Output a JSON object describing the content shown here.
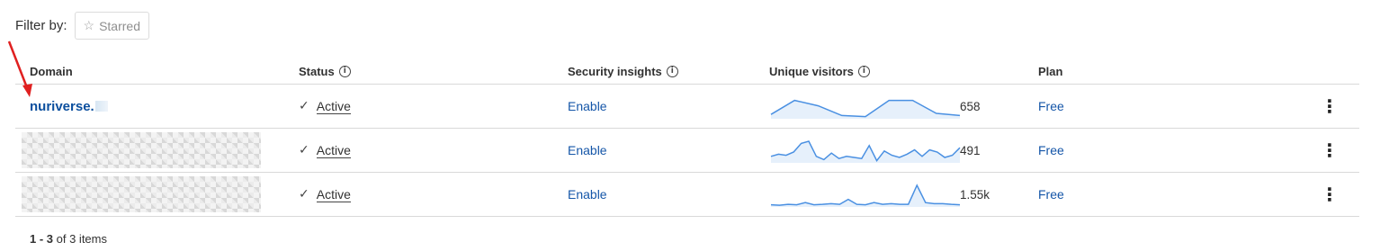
{
  "filter": {
    "label": "Filter by:",
    "starred_label": "Starred",
    "star_icon": "star-outline-icon"
  },
  "columns": {
    "domain": "Domain",
    "status": "Status",
    "security": "Security insights",
    "visitors": "Unique visitors",
    "plan": "Plan"
  },
  "rows": [
    {
      "domain": "nuriverse.",
      "status": "Active",
      "security": "Enable",
      "visitors": "658",
      "plan": "Free",
      "sparkline": [
        0.2,
        0.85,
        0.6,
        0.15,
        0.1,
        0.85,
        0.85,
        0.25,
        0.15
      ]
    },
    {
      "domain": "",
      "status": "Active",
      "security": "Enable",
      "visitors": "491",
      "plan": "Free",
      "sparkline": [
        0.3,
        0.4,
        0.35,
        0.5,
        0.9,
        1.0,
        0.3,
        0.15,
        0.45,
        0.2,
        0.3,
        0.25,
        0.2,
        0.8,
        0.1,
        0.55,
        0.35,
        0.25,
        0.4,
        0.6,
        0.3,
        0.6,
        0.5,
        0.25,
        0.35,
        0.7
      ]
    },
    {
      "domain": "",
      "status": "Active",
      "security": "Enable",
      "visitors": "1.55k",
      "plan": "Free",
      "sparkline": [
        0.1,
        0.08,
        0.12,
        0.1,
        0.2,
        0.1,
        0.12,
        0.15,
        0.12,
        0.35,
        0.12,
        0.1,
        0.2,
        0.12,
        0.15,
        0.12,
        0.12,
        1.0,
        0.2,
        0.15,
        0.15,
        0.12,
        0.1
      ]
    }
  ],
  "pagination": {
    "range": "1 - 3",
    "suffix": "of 3 items"
  },
  "colors": {
    "link": "#1556a8",
    "sparkline": "#4a90e2",
    "sparkline_fill": "#e6f0fb",
    "annotation_arrow": "#e02020"
  }
}
